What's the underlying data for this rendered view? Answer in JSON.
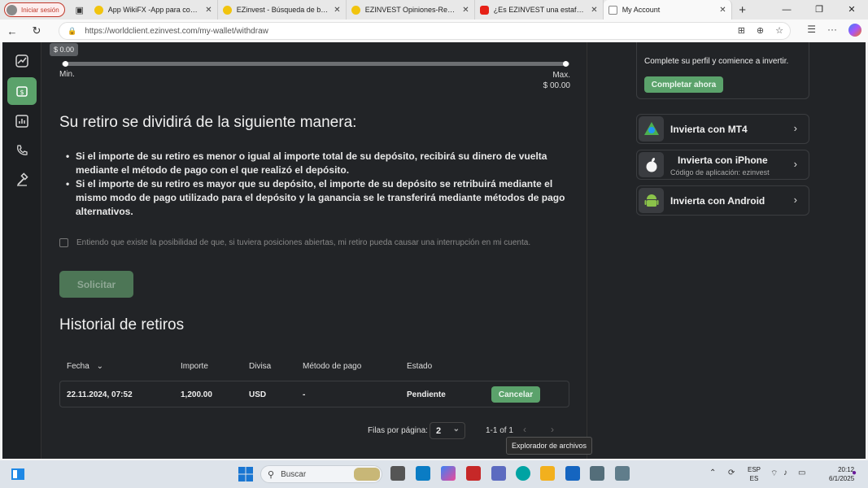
{
  "browser": {
    "profile_label": "Iniciar sesión",
    "tabs": [
      {
        "title": "App WikiFX -App para consulta",
        "active": false
      },
      {
        "title": "EZinvest - Búsqueda de bróker d",
        "active": false
      },
      {
        "title": "EZINVEST Opiniones-Reseñas d",
        "active": false
      },
      {
        "title": "¿Es EZINVEST una estafa? Inver",
        "active": false
      },
      {
        "title": "My Account",
        "active": true
      }
    ],
    "url": "https://worldclient.ezinvest.com/my-wallet/withdraw"
  },
  "slider": {
    "value_badge": "$ 0.00",
    "min_label": "Min.",
    "max_label": "Max.",
    "max_value": "$ 00.00"
  },
  "split": {
    "heading": "Su retiro se dividirá de la siguiente manera:",
    "bullets": [
      "Si el importe de su retiro es menor o igual al importe total de su depósito, recibirá su dinero de vuelta mediante el método de pago con el que realizó el depósito.",
      "Si el importe de su retiro es mayor que su depósito, el importe de su depósito se retribuirá mediante el mismo modo de pago utilizado para el depósito y la ganancia se le transferirá mediante métodos de pago alternativos."
    ],
    "agree_text": "Entiendo que existe la posibilidad de que, si tuviera posiciones abiertas, mi retiro pueda causar una interrupción en mi cuenta.",
    "submit_label": "Solicitar"
  },
  "history": {
    "heading": "Historial de retiros",
    "columns": [
      "Fecha",
      "Importe",
      "Divisa",
      "Método de pago",
      "Estado"
    ],
    "rows": [
      {
        "fecha": "22.11.2024, 07:52",
        "importe": "1,200.00",
        "divisa": "USD",
        "metodo": "-",
        "estado": "Pendiente",
        "action": "Cancelar"
      }
    ],
    "rows_per_page_label": "Filas por página:",
    "rows_per_page": "2",
    "range": "1-1 of 1"
  },
  "tooltip": "Explorador de archivos",
  "sidebar": {
    "profile_text": "Complete su perfil y comience a invertir.",
    "profile_button": "Completar ahora",
    "apps": [
      {
        "label": "Invierta con MT4",
        "sub": ""
      },
      {
        "label": "Invierta con iPhone",
        "sub": "Código de aplicación: ezinvest"
      },
      {
        "label": "Invierta con Android",
        "sub": ""
      }
    ]
  },
  "taskbar": {
    "search_placeholder": "Buscar",
    "lang_top": "ESP",
    "lang_bottom": "ES",
    "time": "20:12",
    "date": "6/1/2025"
  }
}
